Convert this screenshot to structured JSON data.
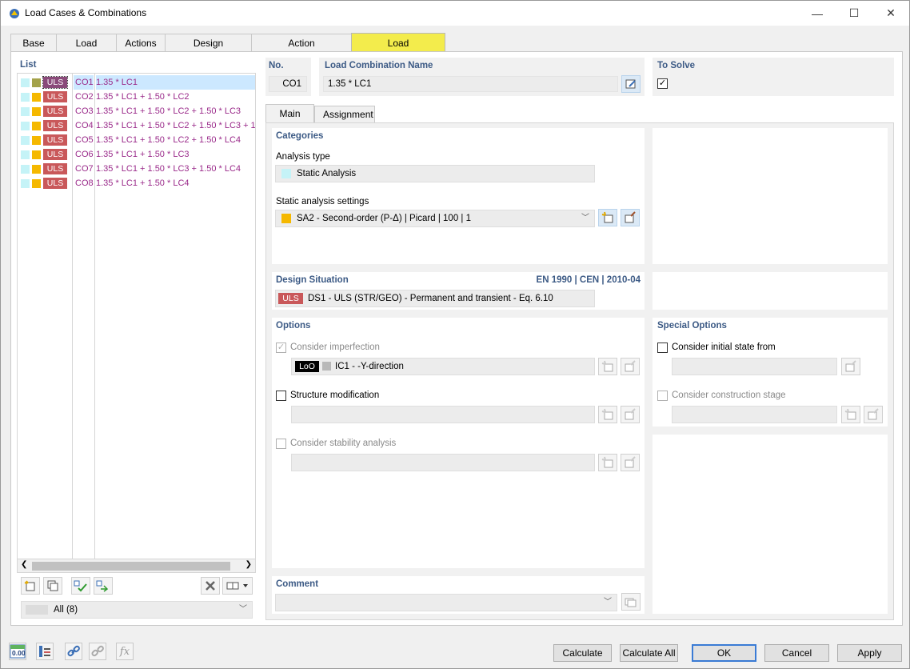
{
  "window": {
    "title": "Load Cases & Combinations",
    "minimize": "—",
    "maximize": "☐",
    "close": "✕"
  },
  "tabs": [
    "Base",
    "Load Cases",
    "Actions",
    "Design Situations",
    "Action Combinations",
    "Load Combinations"
  ],
  "active_tab": "Load Combinations",
  "list": {
    "label": "List",
    "items": [
      {
        "id": "CO1",
        "name": "1.35 * LC1",
        "badge": "ULS",
        "color": "#a4a24a",
        "selected": true
      },
      {
        "id": "CO2",
        "name": "1.35 * LC1 + 1.50 * LC2",
        "badge": "ULS",
        "color": "#f5b800"
      },
      {
        "id": "CO3",
        "name": "1.35 * LC1 + 1.50 * LC2 + 1.50 * LC3",
        "badge": "ULS",
        "color": "#f5b800"
      },
      {
        "id": "CO4",
        "name": "1.35 * LC1 + 1.50 * LC2 + 1.50 * LC3 + 1",
        "badge": "ULS",
        "color": "#f5b800"
      },
      {
        "id": "CO5",
        "name": "1.35 * LC1 + 1.50 * LC2 + 1.50 * LC4",
        "badge": "ULS",
        "color": "#f5b800"
      },
      {
        "id": "CO6",
        "name": "1.35 * LC1 + 1.50 * LC3",
        "badge": "ULS",
        "color": "#f5b800"
      },
      {
        "id": "CO7",
        "name": "1.35 * LC1 + 1.50 * LC3 + 1.50 * LC4",
        "badge": "ULS",
        "color": "#f5b800"
      },
      {
        "id": "CO8",
        "name": "1.35 * LC1 + 1.50 * LC4",
        "badge": "ULS",
        "color": "#f5b800"
      }
    ],
    "filter_value": "All (8)"
  },
  "header": {
    "no_label": "No.",
    "no_value": "CO1",
    "name_label": "Load Combination Name",
    "name_value": "1.35 * LC1",
    "to_solve_label": "To Solve",
    "to_solve_checked": true
  },
  "subtabs": [
    "Main",
    "Assignment"
  ],
  "categories": {
    "title": "Categories",
    "analysis_type_label": "Analysis type",
    "analysis_type_value": "Static Analysis",
    "static_settings_label": "Static analysis settings",
    "static_settings_value": "SA2 - Second-order (P-Δ) | Picard | 100 | 1"
  },
  "design_situation": {
    "title": "Design Situation",
    "standard": "EN 1990 | CEN | 2010-04",
    "badge": "ULS",
    "value": "DS1 - ULS (STR/GEO) - Permanent and transient - Eq. 6.10"
  },
  "options": {
    "title": "Options",
    "imperfection_label": "Consider imperfection",
    "imperfection_badge": "LoO",
    "imperfection_value": "IC1 - -Y-direction",
    "structure_mod_label": "Structure modification",
    "stability_label": "Consider stability analysis"
  },
  "special_options": {
    "title": "Special Options",
    "initial_state_label": "Consider initial state from",
    "construction_stage_label": "Consider construction stage"
  },
  "comment": {
    "title": "Comment",
    "value": ""
  },
  "buttons": {
    "calculate": "Calculate",
    "calculate_all": "Calculate All",
    "ok": "OK",
    "cancel": "Cancel",
    "apply": "Apply"
  },
  "footer_icons": {
    "units": "0.00"
  }
}
